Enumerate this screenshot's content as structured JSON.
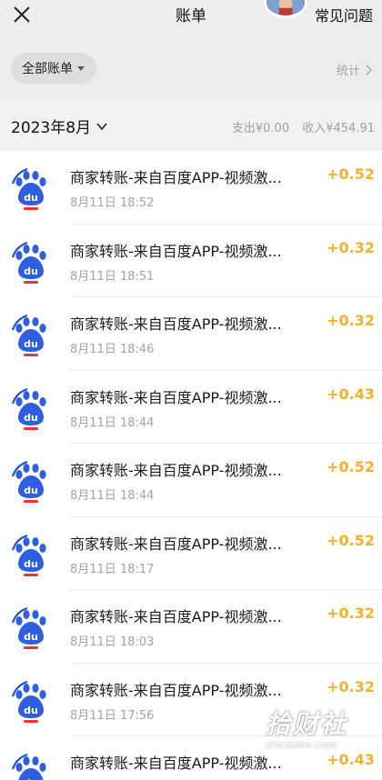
{
  "header": {
    "title": "账单",
    "help_label": "常见问题"
  },
  "filter": {
    "chip_label": "全部账单",
    "stats_label": "统计"
  },
  "month": {
    "label": "2023年8月",
    "expense": "支出¥0.00",
    "income": "收入¥454.91"
  },
  "transactions": [
    {
      "title": "商家转账-来自百度APP-视频激...",
      "date": "8月11日 18:52",
      "amount": "+0.52"
    },
    {
      "title": "商家转账-来自百度APP-视频激...",
      "date": "8月11日 18:51",
      "amount": "+0.32"
    },
    {
      "title": "商家转账-来自百度APP-视频激...",
      "date": "8月11日 18:46",
      "amount": "+0.32"
    },
    {
      "title": "商家转账-来自百度APP-视频激...",
      "date": "8月11日 18:44",
      "amount": "+0.43"
    },
    {
      "title": "商家转账-来自百度APP-视频激...",
      "date": "8月11日 18:44",
      "amount": "+0.52"
    },
    {
      "title": "商家转账-来自百度APP-视频激...",
      "date": "8月11日 18:17",
      "amount": "+0.52"
    },
    {
      "title": "商家转账-来自百度APP-视频激...",
      "date": "8月11日 18:03",
      "amount": "+0.32"
    },
    {
      "title": "商家转账-来自百度APP-视频激...",
      "date": "8月11日 17:56",
      "amount": "+0.32"
    },
    {
      "title": "商家转账-来自百度APP-视频激...",
      "date": "",
      "amount": "+0.43"
    }
  ],
  "icons": {
    "close": "close-icon",
    "avatar": "avatar-icon",
    "merchant": "baidu-paw-icon",
    "stats_chevron": "chevron-right-icon",
    "month_chevron": "chevron-down-icon"
  },
  "colors": {
    "amount": "#f0b228",
    "muted": "#a3a3a3",
    "brand_blue": "#2f5fe0",
    "brand_red": "#e8333a"
  },
  "watermark": {
    "main": "拾财社",
    "sub": "shicaishe.com"
  }
}
